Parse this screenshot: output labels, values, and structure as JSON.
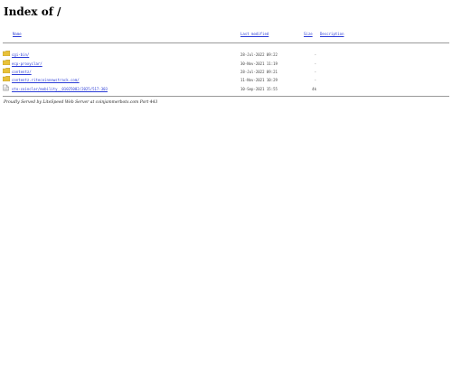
{
  "page": {
    "title": "Index of /"
  },
  "columns": {
    "name": "Name",
    "last_modified": "Last modified",
    "size": "Size",
    "description": "Description"
  },
  "entries": [
    {
      "icon": "folder-icon",
      "name": "cgi-bin/",
      "modified": "28-Jul-2022 09:22",
      "size": "-"
    },
    {
      "icon": "folder-icon",
      "name": "ecp-proxyclar/",
      "modified": "30-Nov-2021 11:19",
      "size": "-"
    },
    {
      "icon": "folder-icon",
      "name": "contentz/",
      "modified": "28-Jul-2022 09:21",
      "size": "-"
    },
    {
      "icon": "folder-icon",
      "name": "contentz.ritecoinnewstrack.com/",
      "modified": "11-Nov-2021 10:29",
      "size": "-"
    },
    {
      "icon": "file-icon",
      "name": "sto-coinclar/mobility__01025082/2025/517-303",
      "modified": "10-Sep-2021 15:55",
      "size": "4k"
    }
  ],
  "footer": "Proudly Served by LiteSpeed Web Server at coinjammerbots.com Port 443",
  "colors": {
    "link": "#2a3bd6",
    "folder": "#e8c13a",
    "rule": "#9a9a9a"
  }
}
